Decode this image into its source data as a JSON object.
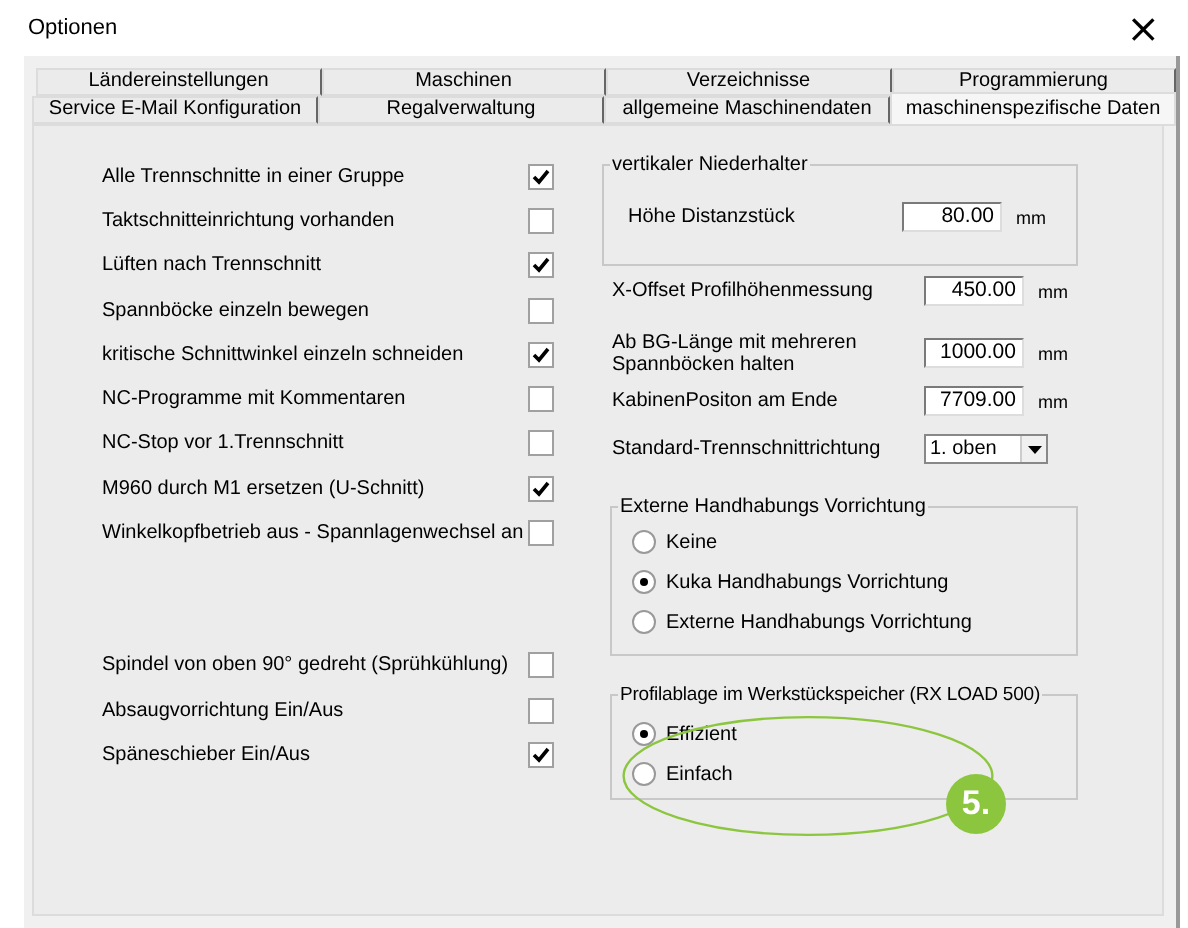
{
  "window": {
    "title": "Optionen",
    "close": "×"
  },
  "tab_rows": [
    [
      {
        "label": "Ländereinstellungen",
        "selected": false
      },
      {
        "label": "Maschinen",
        "selected": false
      },
      {
        "label": "Verzeichnisse",
        "selected": false
      },
      {
        "label": "Programmierung",
        "selected": false
      }
    ],
    [
      {
        "label": "Service E-Mail Konfiguration",
        "selected": false
      },
      {
        "label": "Regalverwaltung",
        "selected": false
      },
      {
        "label": "allgemeine Maschinendaten",
        "selected": false
      },
      {
        "label": "maschinenspezifische Daten",
        "selected": true
      }
    ]
  ],
  "checkboxes_top": [
    {
      "label": "Alle Trennschnitte in einer Gruppe",
      "checked": true
    },
    {
      "label": "Taktschnitteinrichtung vorhanden",
      "checked": false
    },
    {
      "label": "Lüften nach Trennschnitt",
      "checked": true
    },
    {
      "label": "Spannböcke einzeln bewegen",
      "checked": false
    },
    {
      "label": "kritische Schnittwinkel einzeln schneiden",
      "checked": true
    },
    {
      "label": "NC-Programme mit Kommentaren",
      "checked": false
    },
    {
      "label": "NC-Stop vor 1.Trennschnitt",
      "checked": false
    },
    {
      "label": "M960 durch M1 ersetzen (U-Schnitt)",
      "checked": true
    },
    {
      "label": "Winkelkopfbetrieb aus - Spannlagenwechsel an",
      "checked": false
    }
  ],
  "checkboxes_bottom": [
    {
      "label": "Spindel von oben 90° gedreht (Sprühkühlung)",
      "checked": false
    },
    {
      "label": "Absaugvorrichtung Ein/Aus",
      "checked": false
    },
    {
      "label": "Späneschieber Ein/Aus",
      "checked": true
    }
  ],
  "vertical_holder": {
    "title": "vertikaler Niederhalter",
    "label": "Höhe Distanzstück",
    "value": "80.00",
    "unit": "mm"
  },
  "fields": [
    {
      "kind": "field",
      "label": "X-Offset Profilhöhenmessung",
      "value": "450.00",
      "unit": "mm"
    },
    {
      "kind": "field",
      "label": "Ab BG-Länge mit mehreren Spannböcken halten",
      "value": "1000.00",
      "unit": "mm"
    },
    {
      "kind": "field",
      "label": "KabinenPositon am Ende",
      "value": "7709.00",
      "unit": "mm"
    },
    {
      "kind": "combo",
      "label": "Standard-Trennschnittrichtung",
      "value": "1. oben"
    }
  ],
  "radio_groups": [
    {
      "title": "Externe Handhabungs Vorrichtung",
      "options": [
        {
          "label": "Keine",
          "selected": false
        },
        {
          "label": "Kuka Handhabungs Vorrichtung",
          "selected": true
        },
        {
          "label": "Externe Handhabungs Vorrichtung",
          "selected": false
        }
      ]
    },
    {
      "title": "Profilablage im Werkstückspeicher (RX LOAD 500)",
      "highlighted": true,
      "options": [
        {
          "label": "Effizient",
          "selected": true
        },
        {
          "label": "Einfach",
          "selected": false
        }
      ]
    }
  ],
  "annotation": {
    "label": "5."
  }
}
